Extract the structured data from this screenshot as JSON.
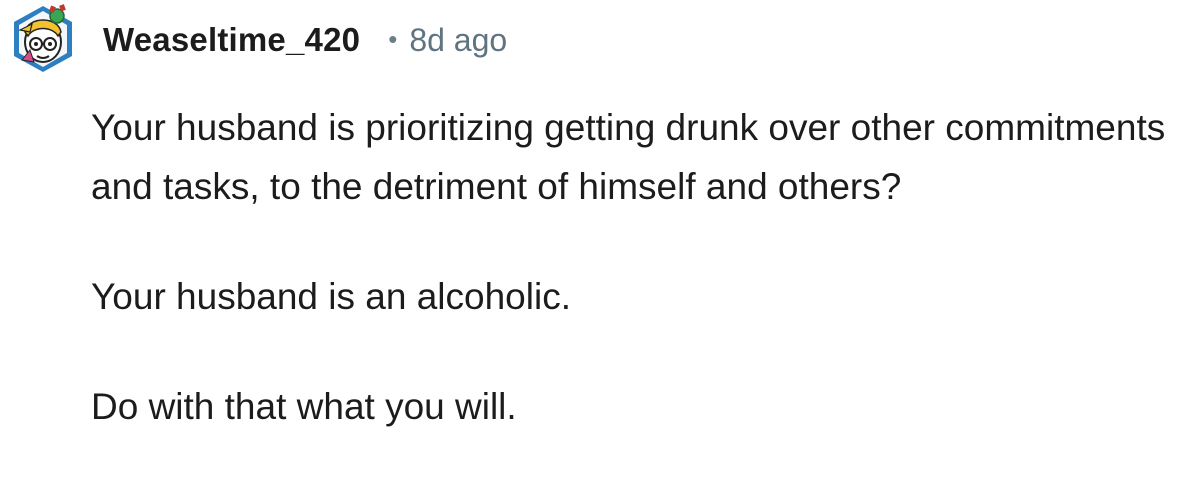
{
  "comment": {
    "author": "Weaseltime_420",
    "separator": "•",
    "timestamp": "8d ago",
    "avatar_icon": "snoo-avatar-icon",
    "paragraphs": [
      "Your husband is prioritizing getting drunk over other commitments and tasks, to the detriment of himself and others?",
      "Your husband is an alcoholic.",
      "Do with that what you will."
    ]
  },
  "colors": {
    "text": "#1c1c1c",
    "meta": "#5f7480",
    "background": "#ffffff"
  }
}
